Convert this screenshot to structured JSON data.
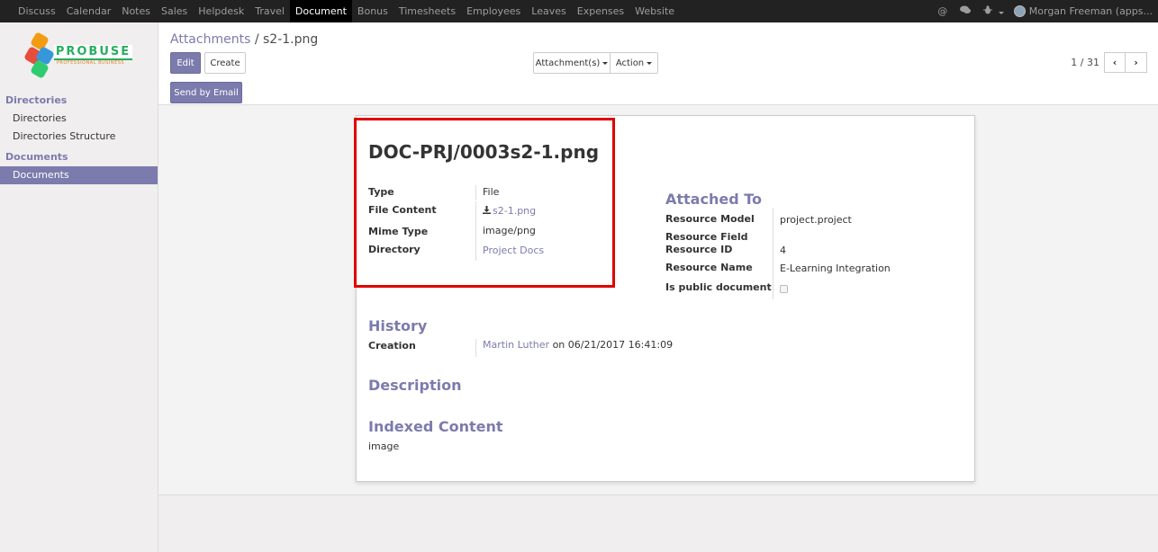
{
  "topnav": {
    "items": [
      "Discuss",
      "Calendar",
      "Notes",
      "Sales",
      "Helpdesk",
      "Travel",
      "Document",
      "Bonus",
      "Timesheets",
      "Employees",
      "Leaves",
      "Expenses",
      "Website"
    ],
    "active": "Document",
    "icons": [
      "at-icon",
      "chat-icon",
      "bug-icon"
    ],
    "user": "Morgan Freeman (apps..."
  },
  "logo": {
    "title": "PROBUSE",
    "subtitle": "PROFESSIONAL BUSINESS"
  },
  "sidebar": {
    "sections": [
      {
        "title": "Directories",
        "items": [
          "Directories",
          "Directories Structure"
        ]
      },
      {
        "title": "Documents",
        "items": [
          "Documents"
        ]
      }
    ],
    "active_item": "Documents"
  },
  "control_panel": {
    "breadcrumb_parent": "Attachments",
    "breadcrumb_sep": "/",
    "breadcrumb_current": "s2-1.png",
    "edit_label": "Edit",
    "create_label": "Create",
    "attachments_label": "Attachment(s)",
    "action_label": "Action",
    "pager_value": "1 / 31",
    "send_email_label": "Send by Email"
  },
  "record": {
    "title": "DOC-PRJ/0003s2-1.png",
    "fields": {
      "type_label": "Type",
      "type_value": "File",
      "file_content_label": "File Content",
      "file_content_value": "s2-1.png",
      "mime_label": "Mime Type",
      "mime_value": "image/png",
      "directory_label": "Directory",
      "directory_value": "Project Docs"
    },
    "attached_to": {
      "title": "Attached To",
      "resource_model_label": "Resource Model",
      "resource_model_value": "project.project",
      "resource_field_label": "Resource Field",
      "resource_id_label": "Resource ID",
      "resource_id_value": "4",
      "resource_name_label": "Resource Name",
      "resource_name_value": "E-Learning Integration",
      "public_label": "Is public document",
      "public_value": false
    },
    "history": {
      "title": "History",
      "creation_label": "Creation",
      "creation_user": "Martin Luther",
      "creation_text": "on 06/21/2017 16:41:09"
    },
    "description": {
      "title": "Description"
    },
    "indexed": {
      "title": "Indexed Content",
      "value": "image"
    }
  },
  "colors": {
    "accent": "#7c7bad",
    "navbar": "#222222",
    "highlight": "#e00000"
  }
}
